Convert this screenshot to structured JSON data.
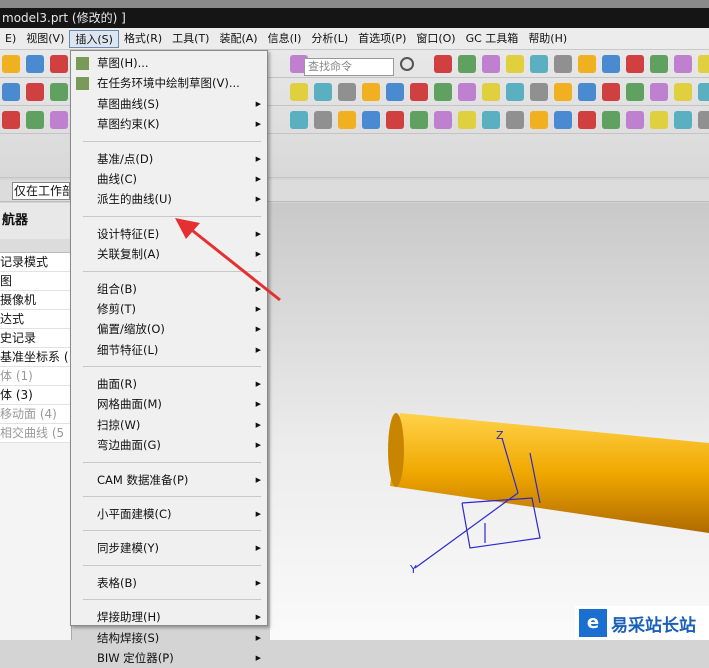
{
  "window": {
    "title": "model3.prt (修改的) ]"
  },
  "menubar": {
    "items": [
      "E)",
      "视图(V)",
      "插入(S)",
      "格式(R)",
      "工具(T)",
      "装配(A)",
      "信息(I)",
      "分析(L)",
      "首选项(P)",
      "窗口(O)",
      "GC 工具箱",
      "帮助(H)"
    ],
    "active": "插入(S)"
  },
  "toolbar": {
    "search_placeholder": "查找命令"
  },
  "filter": {
    "value": "仅在工作部"
  },
  "navigator": {
    "title": "航器",
    "items": [
      {
        "label": "记录模式",
        "dim": false
      },
      {
        "label": "图",
        "dim": false
      },
      {
        "label": "摄像机",
        "dim": false
      },
      {
        "label": "达式",
        "dim": false
      },
      {
        "label": "史记录",
        "dim": false
      },
      {
        "label": "基准坐标系 (",
        "dim": false
      },
      {
        "label": "体 (1)",
        "dim": true
      },
      {
        "label": "体 (3)",
        "dim": false
      },
      {
        "label": "移动面 (4)",
        "dim": true
      },
      {
        "label": "相交曲线 (5",
        "dim": true
      }
    ]
  },
  "insert_menu": {
    "items": [
      {
        "label": "草图(H)...",
        "icon": "sketch-icon"
      },
      {
        "label": "在任务环境中绘制草图(V)...",
        "icon": "sketch-task-icon"
      },
      {
        "label": "草图曲线(S)",
        "submenu": true
      },
      {
        "label": "草图约束(K)",
        "submenu": true
      },
      {
        "sep": true
      },
      {
        "label": "基准/点(D)",
        "submenu": true
      },
      {
        "label": "曲线(C)",
        "submenu": true
      },
      {
        "label": "派生的曲线(U)",
        "submenu": true
      },
      {
        "sep": true
      },
      {
        "label": "设计特征(E)",
        "submenu": true
      },
      {
        "label": "关联复制(A)",
        "submenu": true
      },
      {
        "sep": true
      },
      {
        "label": "组合(B)",
        "submenu": true
      },
      {
        "label": "修剪(T)",
        "submenu": true
      },
      {
        "label": "偏置/缩放(O)",
        "submenu": true
      },
      {
        "label": "细节特征(L)",
        "submenu": true
      },
      {
        "sep": true
      },
      {
        "label": "曲面(R)",
        "submenu": true
      },
      {
        "label": "网格曲面(M)",
        "submenu": true
      },
      {
        "label": "扫掠(W)",
        "submenu": true
      },
      {
        "label": "弯边曲面(G)",
        "submenu": true
      },
      {
        "sep": true
      },
      {
        "label": "CAM 数据准备(P)",
        "submenu": true
      },
      {
        "sep": true
      },
      {
        "label": "小平面建模(C)",
        "submenu": true
      },
      {
        "sep": true
      },
      {
        "label": "同步建模(Y)",
        "submenu": true
      },
      {
        "sep": true
      },
      {
        "label": "表格(B)",
        "submenu": true
      },
      {
        "sep": true
      },
      {
        "label": "焊接助理(H)",
        "submenu": true
      },
      {
        "label": "结构焊接(S)",
        "submenu": true
      },
      {
        "label": "BIW 定位器(P)",
        "submenu": true
      }
    ]
  },
  "viewport": {
    "axis_z": "Z",
    "axis_y": "Y",
    "body_color": "#f0a800",
    "annotation_color": "#e53030"
  },
  "watermark": {
    "logo": "e",
    "text": "易采站长站"
  }
}
